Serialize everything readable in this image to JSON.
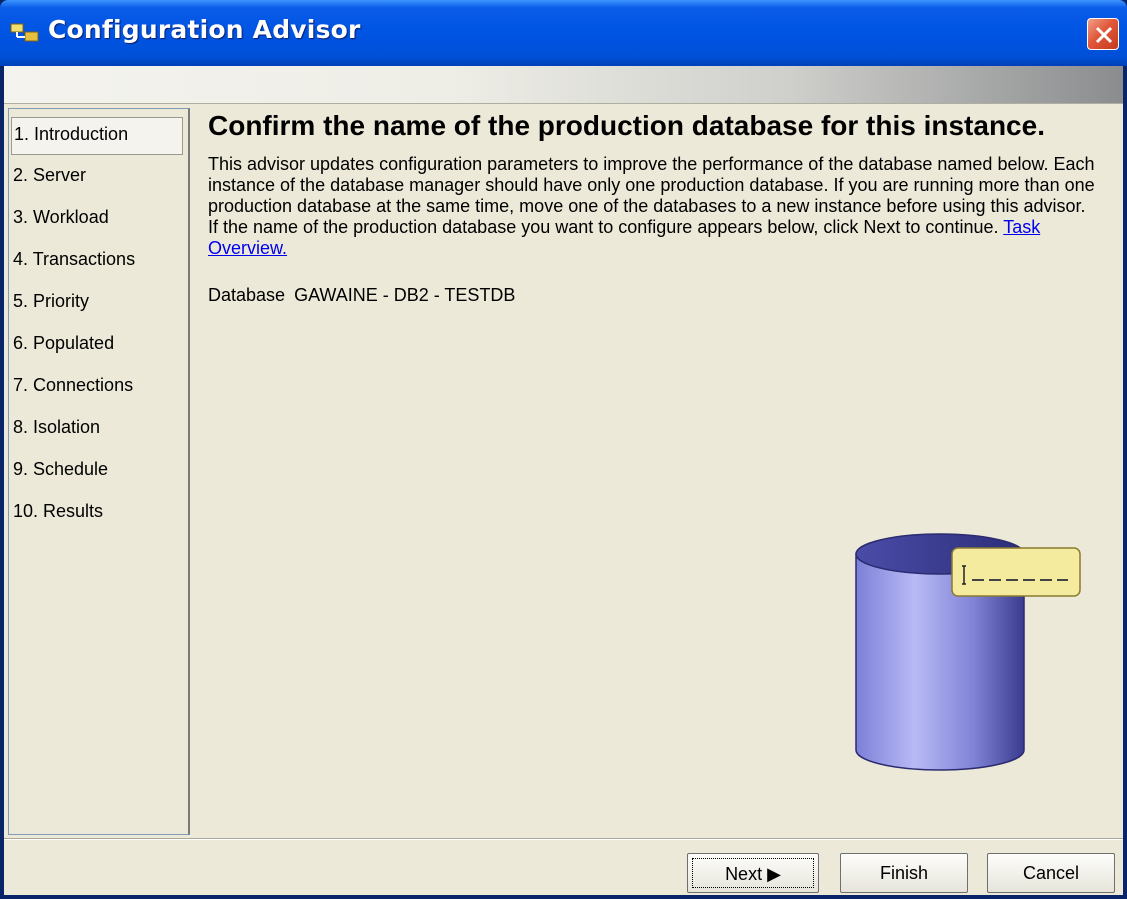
{
  "window": {
    "title": "Configuration Advisor",
    "close_icon": "close-icon"
  },
  "steps": [
    {
      "label": "1. Introduction",
      "active": true
    },
    {
      "label": "2. Server"
    },
    {
      "label": "3. Workload"
    },
    {
      "label": "4. Transactions"
    },
    {
      "label": "5. Priority"
    },
    {
      "label": "6. Populated"
    },
    {
      "label": "7. Connections"
    },
    {
      "label": "8. Isolation"
    },
    {
      "label": "9. Schedule"
    },
    {
      "label": "10. Results"
    }
  ],
  "main": {
    "heading": "Confirm the name of the production database for this instance.",
    "paragraph1": "This advisor updates configuration parameters to improve the performance of the database named below. Each instance of the database manager should have only one production database. If you are running more than one production database at the same time, move one of the databases to a new instance before using this advisor.",
    "paragraph2": "If the name of the production database you want to configure appears below, click Next to continue.",
    "link": "Task Overview.",
    "db_label": "Database",
    "db_value": "GAWAINE - DB2 - TESTDB"
  },
  "buttons": {
    "next": "Next",
    "finish": "Finish",
    "cancel": "Cancel"
  },
  "colors": {
    "titlebar": "#0054e3",
    "background": "#ece9d8",
    "link": "#0000ee"
  }
}
